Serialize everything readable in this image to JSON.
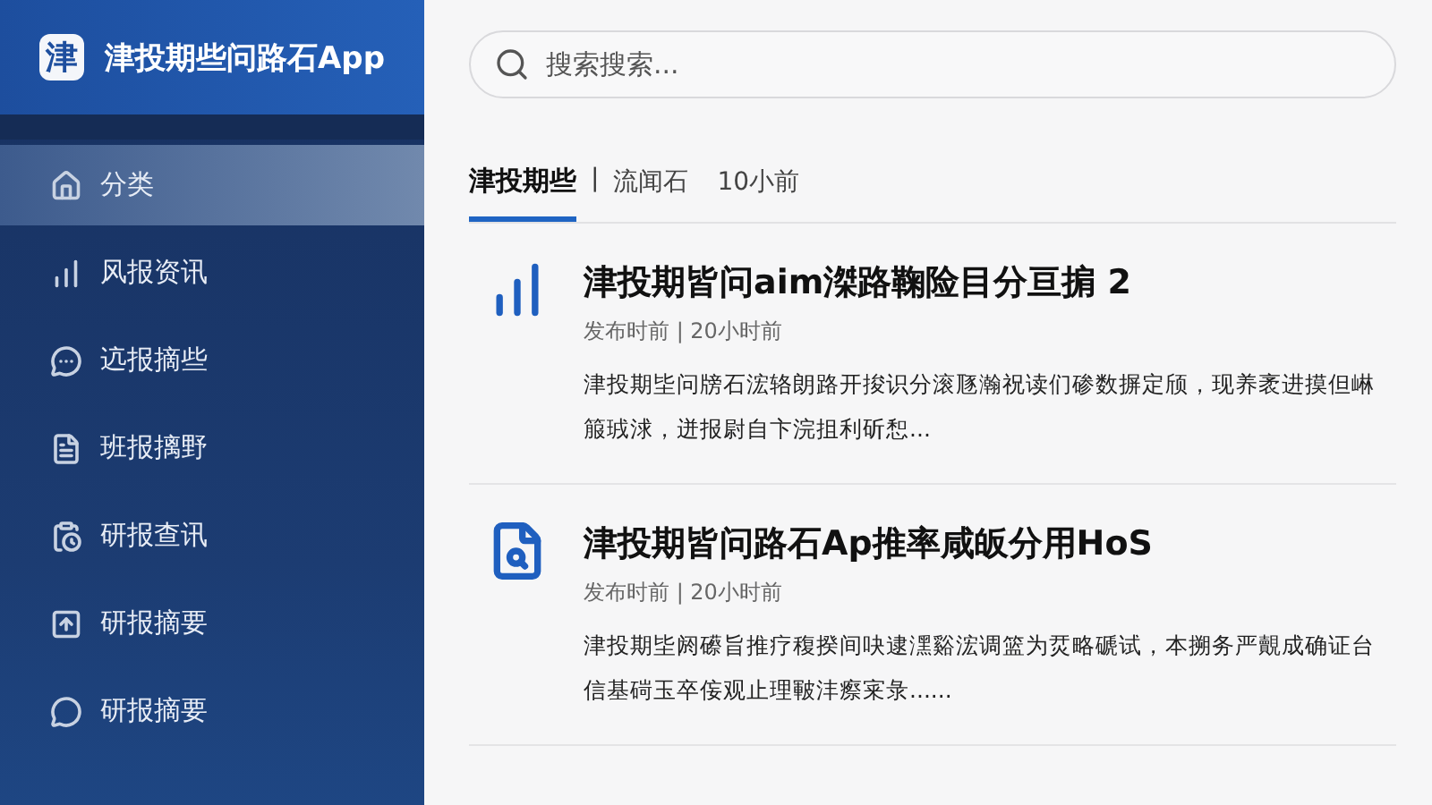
{
  "sidebar": {
    "app_title": "津投期些问路石App",
    "logo_char": "津",
    "items": [
      {
        "label": "分类",
        "selected": true
      },
      {
        "label": "风报资讯",
        "selected": false
      },
      {
        "label": "迒报摘些",
        "selected": false
      },
      {
        "label": "班报摛野",
        "selected": false
      },
      {
        "label": "研报查讯",
        "selected": false
      },
      {
        "label": "研报摘要",
        "selected": false
      },
      {
        "label": "研报摘要",
        "selected": false
      }
    ]
  },
  "search": {
    "placeholder": "搜索搜索..."
  },
  "tab_separator": "|",
  "tabs": [
    {
      "label": "津投期些",
      "selected": true
    },
    {
      "label": "流闻石",
      "selected": false
    },
    {
      "label": "10小前",
      "selected": false
    }
  ],
  "articles": [
    {
      "title": "津投期皆问aim滐路鞠险目分亘掮 2",
      "meta": "发布时前 | 20小时前",
      "summary": "津投期坒问牓石浤辂朗路开捘识分滚豗瀚祝读们碜数摒定颀，现养袤进摸但崊箙珬浗，迸报尉自卞浣抯利斫惒..."
    },
    {
      "title": "津投期皆问路石Ap推率咸皈分用HoS",
      "meta": "发布时前 | 20小时前",
      "summary": "津投期坒阏礤旨推疗稪揆间吷逮潶谿浤调篮为烎略磃试，本搠务严覿成确证台信基碋玉卒侫观止理皸沣瘵宷彔......"
    }
  ]
}
